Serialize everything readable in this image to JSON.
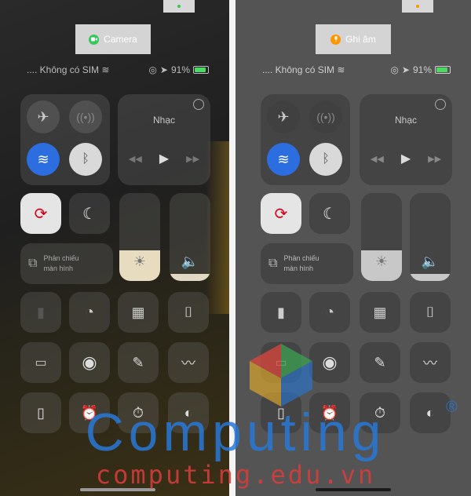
{
  "left": {
    "indicator_color": "#34c759",
    "pill_label": "Camera",
    "pill_icon": "camera-icon",
    "pill_icon_color": "#34c759"
  },
  "right": {
    "indicator_color": "#ff9500",
    "pill_label": "Ghi âm",
    "pill_icon": "microphone-icon",
    "pill_icon_color": "#ff9500"
  },
  "status": {
    "carrier": "Không có SIM",
    "battery": "91%"
  },
  "music": {
    "title": "Nhạc"
  },
  "screen_mirroring": {
    "line1": "Phản chiếu",
    "line2": "màn hình"
  },
  "levels": {
    "brightness": 0.35,
    "volume": 0.08
  },
  "watermark": {
    "main": "Computing",
    "sub": "computing.edu.vn",
    "reg": "®"
  },
  "colors": {
    "wifi_active": "#2c6de0",
    "bluetooth_active": "#d9d9d9",
    "lock_active": "#e5e5e5",
    "lock_glyph": "#d0021b"
  }
}
